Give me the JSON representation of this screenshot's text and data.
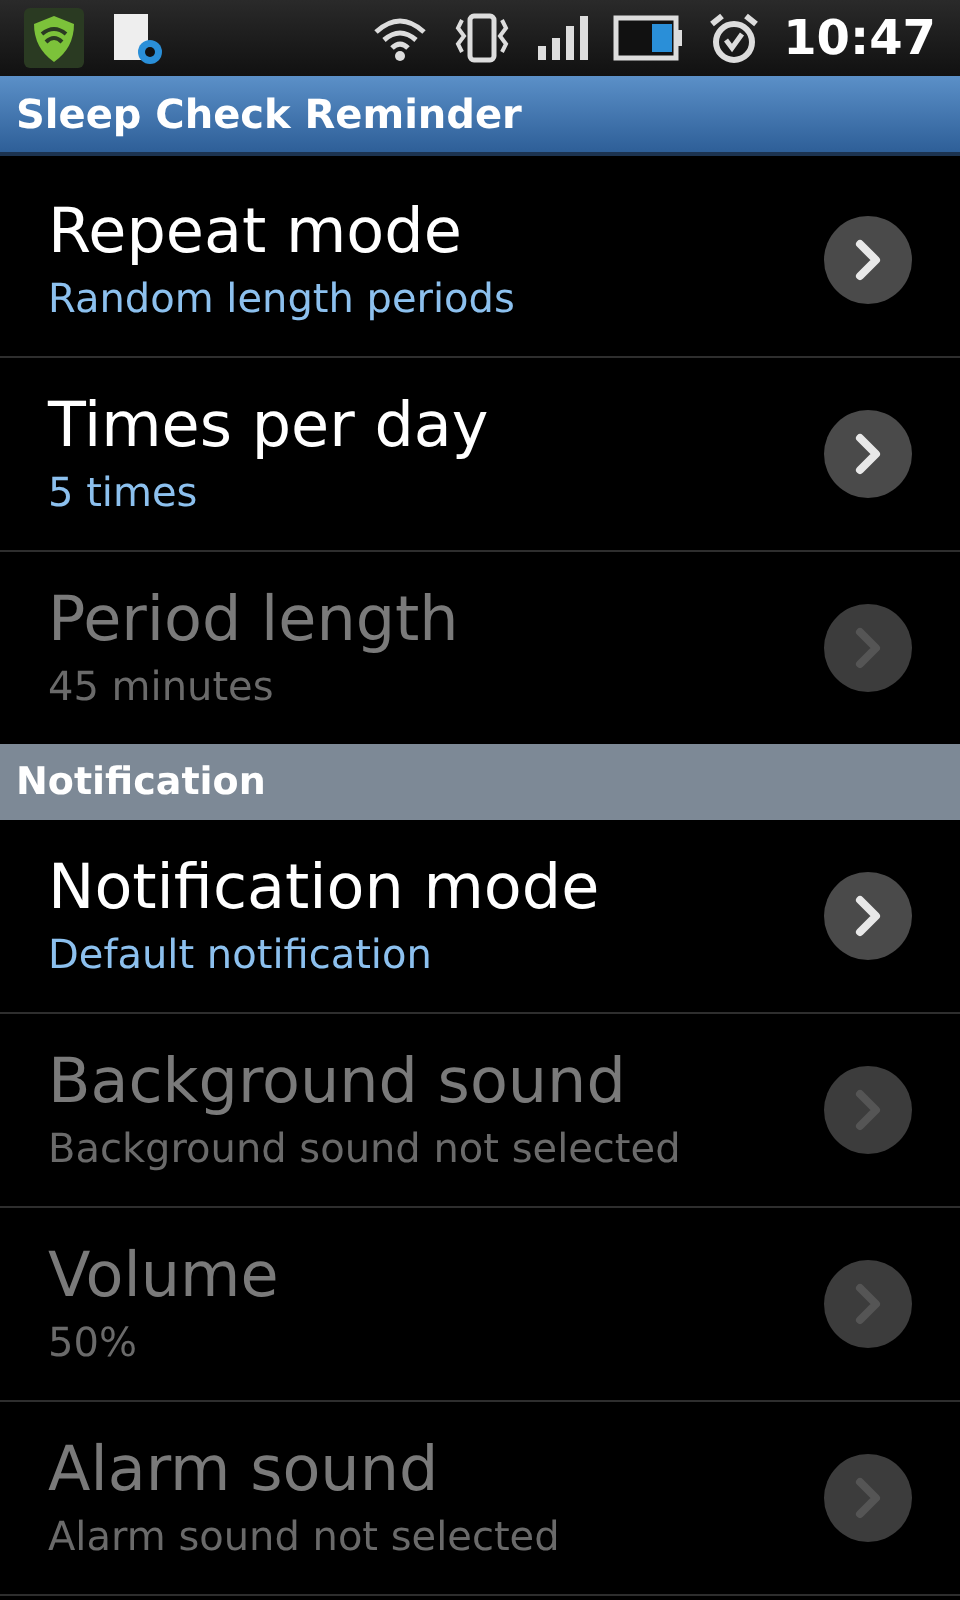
{
  "status_bar": {
    "time": "10:47"
  },
  "title_bar": {
    "title": "Sleep Check Reminder"
  },
  "items": [
    {
      "kind": "row",
      "title": "Repeat mode",
      "summary": "Random length periods",
      "disabled": false
    },
    {
      "kind": "row",
      "title": "Times per day",
      "summary": "5 times",
      "disabled": false
    },
    {
      "kind": "row",
      "title": "Period length",
      "summary": "45 minutes",
      "disabled": true
    },
    {
      "kind": "header",
      "title": "Notification"
    },
    {
      "kind": "row",
      "title": "Notification mode",
      "summary": "Default notification",
      "disabled": false
    },
    {
      "kind": "row",
      "title": "Background sound",
      "summary": "Background sound not selected",
      "disabled": true
    },
    {
      "kind": "row",
      "title": "Volume",
      "summary": "50%",
      "disabled": true
    },
    {
      "kind": "row",
      "title": "Alarm sound",
      "summary": "Alarm sound not selected",
      "disabled": true
    }
  ]
}
